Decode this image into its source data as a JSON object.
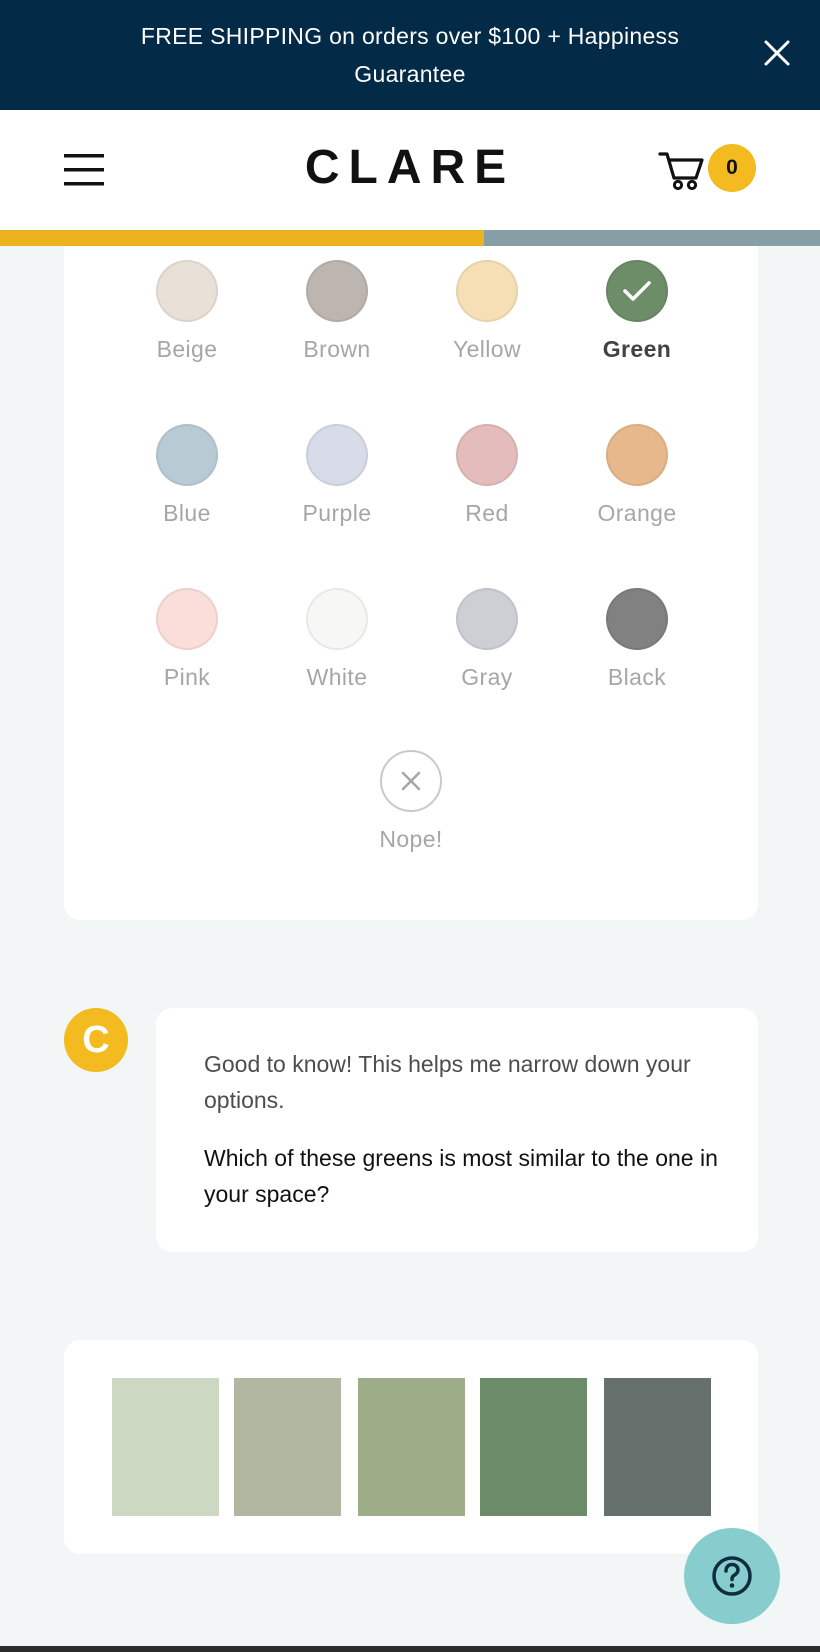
{
  "promo": {
    "text": "FREE SHIPPING on orders over $100 + Happiness Guarantee",
    "close_icon": "close-icon"
  },
  "header": {
    "menu_icon": "hamburger-menu-icon",
    "logo": "CLARE",
    "cart_icon": "cart-icon",
    "cart_count": "0"
  },
  "progress": {
    "fraction": 0.59,
    "fill_color": "#ecb31f",
    "track_color": "#869fa7"
  },
  "color_picker": {
    "swatches": [
      {
        "label": "Beige",
        "color": "#e9e1d8",
        "selected": false
      },
      {
        "label": "Brown",
        "color": "#bdb5b0",
        "selected": false
      },
      {
        "label": "Yellow",
        "color": "#f6dfb5",
        "selected": false
      },
      {
        "label": "Green",
        "color": "#6d8d68",
        "selected": true
      },
      {
        "label": "Blue",
        "color": "#b8cbd4",
        "selected": false
      },
      {
        "label": "Purple",
        "color": "#d8dbe8",
        "selected": false
      },
      {
        "label": "Red",
        "color": "#e3bcbb",
        "selected": false
      },
      {
        "label": "Orange",
        "color": "#e6b88c",
        "selected": false
      },
      {
        "label": "Pink",
        "color": "#fbddd9",
        "selected": false
      },
      {
        "label": "White",
        "color": "#f7f7f6",
        "selected": false
      },
      {
        "label": "Gray",
        "color": "#ccd0d4",
        "selected": false
      },
      {
        "label": "Black",
        "color": "#818181",
        "selected": false
      }
    ],
    "nope": {
      "label": "Nope!",
      "icon": "close-icon"
    }
  },
  "chat": {
    "avatar_letter": "C",
    "message": "Good to know! This helps me narrow down your options.",
    "question": "Which of these greens is most similar to the one in your space?"
  },
  "greens": [
    {
      "color": "#ccd8c2"
    },
    {
      "color": "#b1b7a0"
    },
    {
      "color": "#9cad87"
    },
    {
      "color": "#6b8b69"
    },
    {
      "color": "#656f6b"
    }
  ],
  "help": {
    "icon": "help-question-icon"
  }
}
